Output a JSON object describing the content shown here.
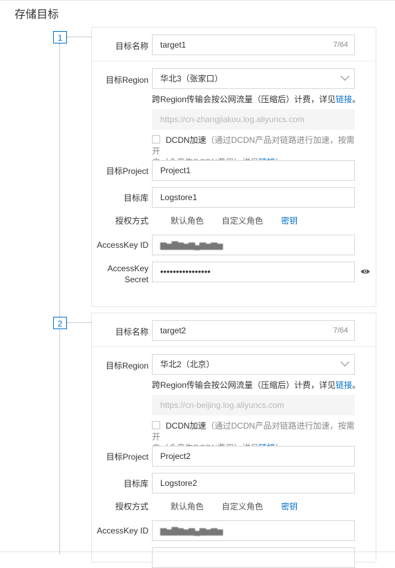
{
  "section_title": "存储目标",
  "labels": {
    "target_name": "目标名称",
    "target_region": "目标Region",
    "target_project": "目标Project",
    "target_logstore": "目标库",
    "auth_method": "授权方式",
    "access_key_id": "AccessKey ID",
    "access_key_secret_line1": "AccessKey",
    "access_key_secret_line2": "Secret"
  },
  "region_note": {
    "text": "跨Region传输会按公网流量（压缩后）计费，详见",
    "link": "链接",
    "end": "。"
  },
  "dcdn": {
    "label": "DCDN加速",
    "desc_line1": "（通过DCDN产品对链路进行加速，按需开",
    "desc_line2": "启（会产生DCDN费用）详见",
    "link": "链接",
    "end": "）"
  },
  "auth_options": [
    "默认角色",
    "自定义角色",
    "密钥"
  ],
  "targets": [
    {
      "step": "1",
      "name": "target1",
      "name_count": "7/64",
      "region": "华北3（张家口）",
      "endpoint": "https://cn-zhangjiakou.log.aliyuncs.com",
      "project": "Project1",
      "logstore": "Logstore1",
      "access_key_id": "▆▅▇▆▅▆▄▆▅▆▅",
      "access_key_secret": "••••••••••••••••"
    },
    {
      "step": "2",
      "name": "target2",
      "name_count": "7/64",
      "region": "华北2（北京）",
      "endpoint": "https://cn-beijing.log.aliyuncs.com",
      "project": "Project2",
      "logstore": "Logstore2",
      "access_key_id": "▆▅▇▆▅▆▄▆▅▆▅"
    }
  ],
  "icons": {
    "eye": "eye-icon",
    "chevron": "chevron-down-icon",
    "checkbox": "checkbox"
  },
  "colors": {
    "link": "#0070cc",
    "step": "#0070cc"
  }
}
